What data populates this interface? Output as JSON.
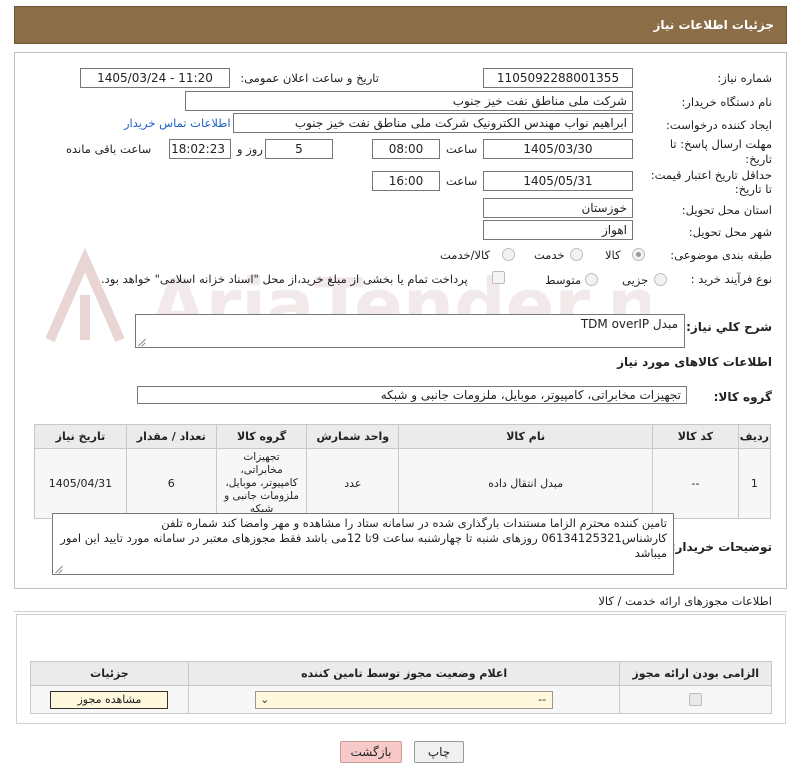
{
  "header": {
    "title": "جزئیات اطلاعات نیاز"
  },
  "form": {
    "need_number_label": "شماره نیاز:",
    "need_number": "1105092288001355",
    "announce_label": "تاریخ و ساعت اعلان عمومی:",
    "announce_value": "1405/03/24 - 11:20",
    "buyer_org_label": "نام دستگاه خریدار:",
    "buyer_org": "شرکت ملی مناطق نفت خیز جنوب",
    "creator_label": "ایجاد کننده درخواست:",
    "creator": "ابراهیم نواب مهندس الکترونیک شرکت ملی مناطق نفت خیز جنوب",
    "contact_link": "اطلاعات تماس خریدار",
    "deadline_label_1": "مهلت ارسال پاسخ: تا",
    "deadline_label_2": "تاریخ:",
    "deadline_date": "1405/03/30",
    "time_label": "ساعت",
    "deadline_time": "08:00",
    "days_value": "5",
    "days_label": "روز و",
    "remaining_time": "18:02:23",
    "remaining_label": "ساعت باقی مانده",
    "price_label_1": "حداقل تاریخ اعتبار قیمت:",
    "price_label_2": "تا تاریخ:",
    "price_date": "1405/05/31",
    "price_time": "16:00",
    "province_label": "استان محل تحویل:",
    "province": "خوزستان",
    "city_label": "شهر محل تحویل:",
    "city": "اهواز",
    "category_label": "طبقه بندی موضوعی:",
    "category_options": [
      "کالا",
      "خدمت",
      "کالا/خدمت"
    ],
    "category_selected": "کالا",
    "process_label": "نوع فرآیند خرید :",
    "process_options": [
      "جزیی",
      "متوسط"
    ],
    "process_selected": "متوسط",
    "payment_note": "پرداخت تمام یا بخشی از مبلغ خرید،از محل \"اسناد خزانه اسلامی\" خواهد بود."
  },
  "description": {
    "label": "شرح کلي نياز:",
    "value": "مبدل TDM overIP"
  },
  "goods": {
    "section_title": "اطلاعات کالاهای مورد نیاز",
    "group_label": "گروه کالا:",
    "group_value": "تجهیزات مخابراتی، کامپیوتر، موبایل، ملزومات جانبی و شبکه",
    "columns": [
      "ردیف",
      "کد کالا",
      "نام کالا",
      "واحد شمارش",
      "گروه کالا",
      "تعداد / مقدار",
      "تاریخ نیاز"
    ],
    "rows": [
      {
        "row": "1",
        "code": "--",
        "name": "مبدل انتقال داده",
        "unit": "عدد",
        "group": "تجهیزات مخابراتی، کامپیوتر، موبایل، ملزومات جانبی و شبکه",
        "qty": "6",
        "date": "1405/04/31"
      }
    ]
  },
  "buyer_notes": {
    "label": "توضیحات خریدار:",
    "value": "تامین کننده محترم الزاما مستندات بارگذاری شده در سامانه ستاد را مشاهده و مهر وامضا کند شماره تلفن کارشناس06134125321 روزهای شنبه تا چهارشنبه ساعت 9تا 12می باشد فقط مجوزهای معتبر در سامانه مورد تایید این امور میباشد"
  },
  "permits": {
    "section_title": "اطلاعات مجوزهای ارائه خدمت / کالا",
    "columns": [
      "الزامی بودن ارائه مجوز",
      "اعلام وضعیت مجوز توسط تامین کننده",
      "جزئیات"
    ],
    "select_value": "--",
    "view_button": "مشاهده مجوز"
  },
  "actions": {
    "print": "چاپ",
    "back": "بازگشت"
  },
  "colors": {
    "header_bg": "#8b6d47",
    "link": "#1a63c7",
    "back_bg": "#f7c9c9",
    "input_yellow": "#fff8dc"
  }
}
